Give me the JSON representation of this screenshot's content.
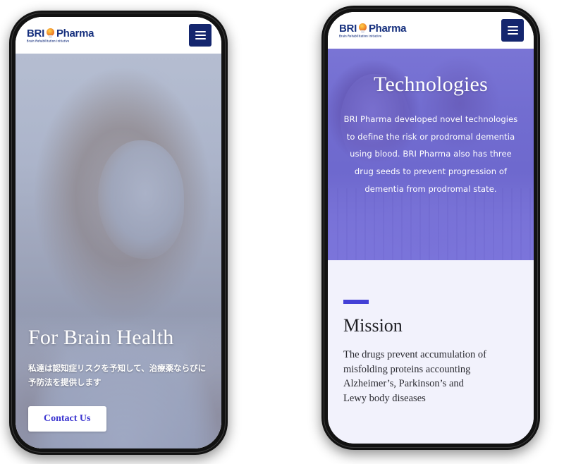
{
  "colors": {
    "brand_navy": "#14266e",
    "accent_indigo": "#4340d6",
    "hero_overlay_purple": "#6a62d8",
    "page_background": "#f2f2fc",
    "button_text": "#3b35d0"
  },
  "phone_1": {
    "header": {
      "logo": {
        "name_part_1": "BRI",
        "name_part_2": "Pharma",
        "tagline": "Brain Rehabilitation Initiative",
        "mark_icon": "lightbulb-brain-icon"
      },
      "menu_button": {
        "icon": "hamburger-menu-icon",
        "label": "Menu"
      }
    },
    "hero": {
      "photo_alt": "Smiling elderly woman",
      "title": "For Brain Health",
      "subtitle": "私達は認知症リスクを予知して、治療薬ならびに予防法を提供します",
      "cta_label": "Contact Us"
    }
  },
  "phone_2": {
    "header": {
      "logo": {
        "name_part_1": "BRI",
        "name_part_2": "Pharma",
        "tagline": "Brain Rehabilitation Initiative",
        "mark_icon": "lightbulb-brain-icon"
      },
      "menu_button": {
        "icon": "hamburger-menu-icon",
        "label": "Menu"
      }
    },
    "hero": {
      "photo_alt": "Researchers working in a laboratory",
      "title": "Technologies",
      "body": "BRI Pharma developed novel technologies to define the risk or prodromal dementia using blood. BRI Pharma also has three drug seeds to prevent progression of dementia from prodromal state."
    },
    "mission": {
      "title": "Mission",
      "body": "The drugs prevent accumulation of misfolding proteins accounting Alzheimer’s, Parkinson’s and Lewy body diseases"
    }
  }
}
